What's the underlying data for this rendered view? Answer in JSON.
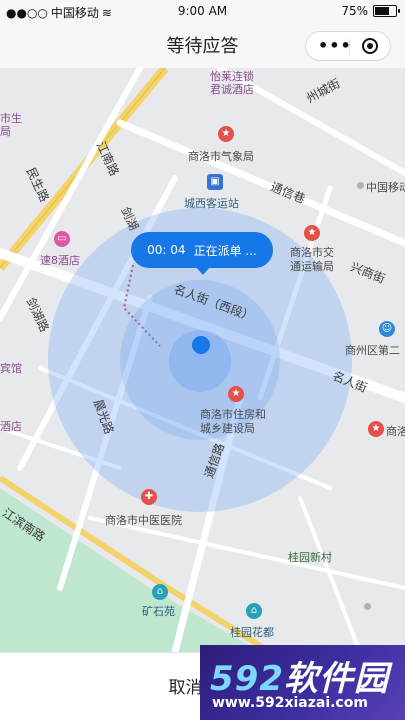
{
  "status_bar": {
    "signal": "●●○○",
    "carrier": "中国移动",
    "wifi": "≋",
    "time": "9:00 AM",
    "battery_percent": "75%",
    "battery_level": 0.75
  },
  "nav": {
    "title": "等待应答",
    "more_glyph": "•••"
  },
  "bubble": {
    "timer": "00: 04",
    "status": "正在派单 ..."
  },
  "map": {
    "labels": {
      "yilaidian": "怡莱连锁",
      "yilaidian2": "君诚酒店",
      "zhouchengjie": "州城街",
      "chengsheng": "市生",
      "chengsheng2": "局",
      "weather": "商洛市气象局",
      "jiangnan_rd": "江南路",
      "minsheng_rd": "民生路",
      "chengxi_station": "城西客运站",
      "tongxin_alley": "通信巷",
      "china_mobile": "中国移动",
      "jianhu1": "剑湖",
      "jianhu2": "路",
      "su8": "速8酒店",
      "traffic": "商洛市交",
      "traffic2": "通运输局",
      "xingshang_st": "兴商街",
      "jianhu_rd": "剑湖路",
      "mingren_st": "名人街（西段）",
      "shangzhou": "商州区第二",
      "binguan": "宾馆",
      "mingren_st2": "名人街",
      "chenguang": "晨光路",
      "housing": "商洛市住房和",
      "housing2": "城乡建设局",
      "jiudian": "酒店",
      "shangluo_right": "商洛",
      "tongxin_rd": "通信路",
      "jiangbin_rd": "江滨南路",
      "tcm_hospital": "商洛市中医医院",
      "guiyuan_xincun": "桂园新村",
      "kuangshiyuan": "矿石苑",
      "guiyuan_huadu": "桂园花都"
    }
  },
  "bottom": {
    "cancel_label": "取消订单"
  },
  "watermark": {
    "logo_a": "592",
    "logo_b": "软件园",
    "url": "www.592xiazai.com"
  }
}
